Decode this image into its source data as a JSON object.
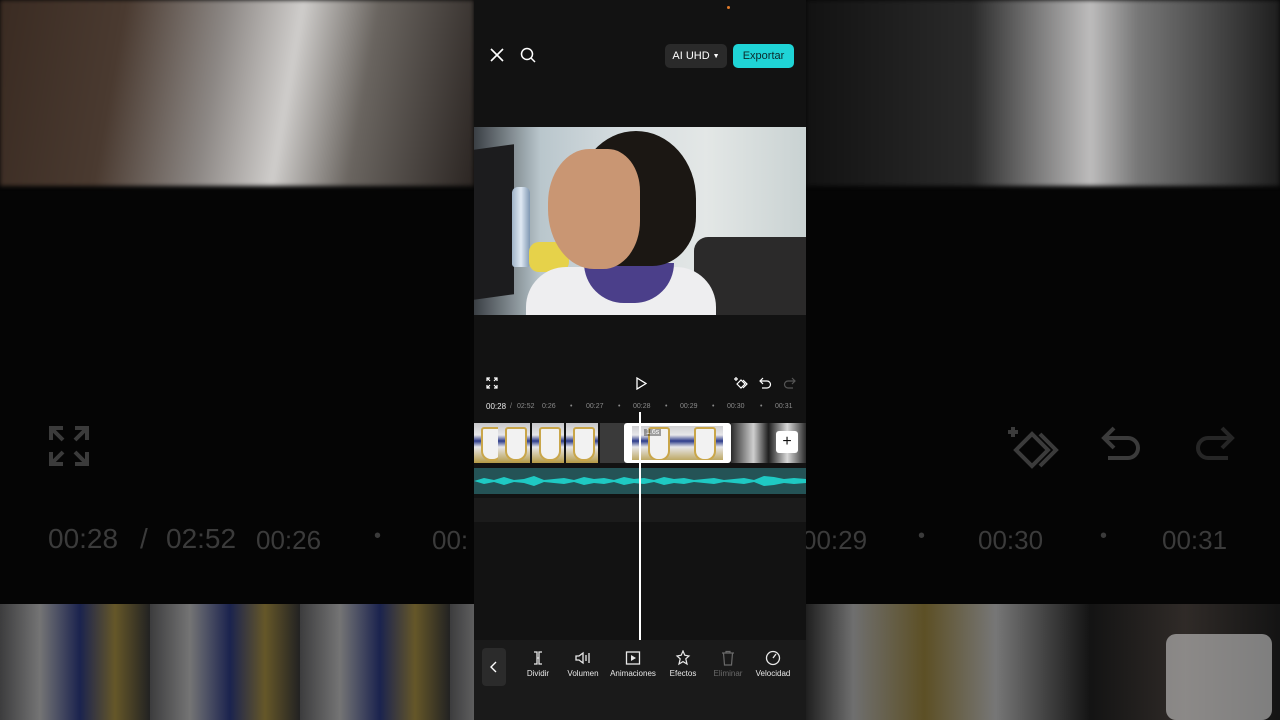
{
  "background": {
    "time_current": "00:28",
    "time_separator": "/",
    "time_total": "02:52",
    "ticks": [
      "00:26",
      "00:",
      "00:29",
      "00:30",
      "00:31"
    ]
  },
  "topbar": {
    "quality_label": "AI UHD",
    "export_label": "Exportar"
  },
  "timeline": {
    "current": "00:28",
    "separator": "/",
    "total": "02:52",
    "ticks": [
      "0:26",
      "00:27",
      "00:28",
      "00:29",
      "00:30",
      "00:31"
    ],
    "selected_clip_label": "1.6s"
  },
  "toolbar": {
    "tools": [
      {
        "label": "Dividir",
        "icon": "split-icon"
      },
      {
        "label": "Volumen",
        "icon": "volume-icon"
      },
      {
        "label": "Animaciones",
        "icon": "animation-icon"
      },
      {
        "label": "Efectos",
        "icon": "effects-icon"
      },
      {
        "label": "Eliminar",
        "icon": "delete-icon",
        "disabled": true
      },
      {
        "label": "Velocidad",
        "icon": "speed-icon"
      }
    ]
  },
  "colors": {
    "accent": "#1fd4d6",
    "audio_track": "#245356",
    "waveform": "#1fc9c3"
  }
}
